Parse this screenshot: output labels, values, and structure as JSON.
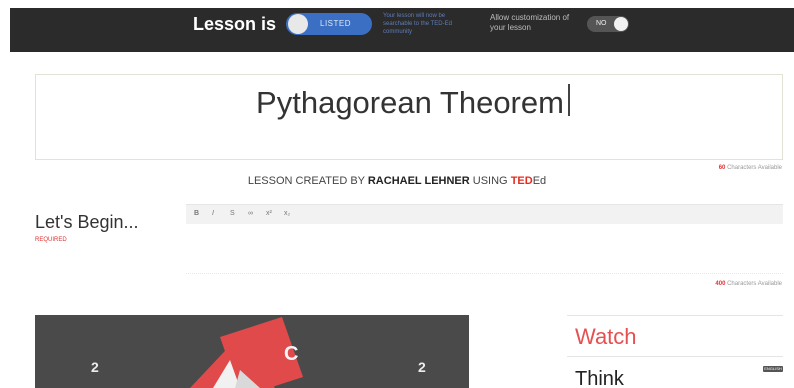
{
  "topbar": {
    "lesson_is_label": "Lesson is",
    "listed_toggle_label": "LISTED",
    "listed_note": "Your lesson will now be searchable to the TED-Ed community",
    "customization_note": "Allow customization of your lesson",
    "customization_toggle_label": "NO"
  },
  "title": {
    "text": "Pythagorean Theorem",
    "chars_count": "60",
    "chars_label": "Characters Available"
  },
  "credit": {
    "prefix": "LESSON CREATED BY",
    "author": "RACHAEL LEHNER",
    "using": "USING",
    "ted": "TED",
    "ed": "Ed"
  },
  "begin": {
    "label": "Let's Begin...",
    "required": "REQUIRED",
    "toolbar": [
      "B",
      "I",
      "S",
      "∞",
      "x²",
      "x₂"
    ],
    "chars_count": "400",
    "chars_label": "Characters Available"
  },
  "video": {
    "letter": "C",
    "left_number": "2",
    "right_number": "2"
  },
  "side": {
    "watch": "Watch",
    "think": "Think",
    "badge": "ENGLISH"
  },
  "colors": {
    "topbar": "#2b2b2b",
    "accent_red": "#e62b1e",
    "watch_red": "#e65050",
    "toggle_blue": "#3a6fc4"
  }
}
